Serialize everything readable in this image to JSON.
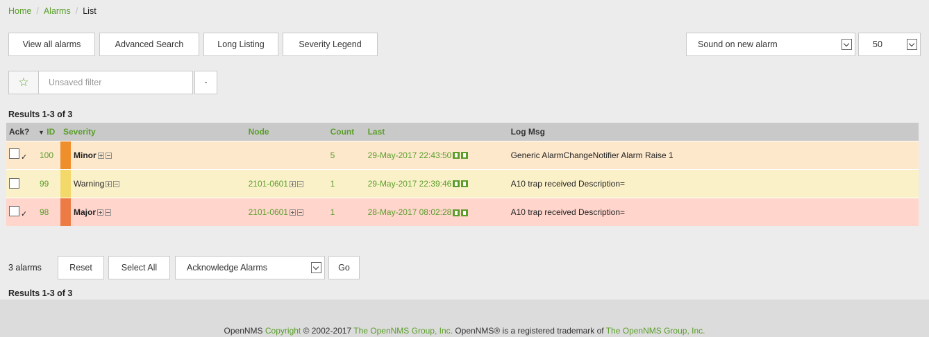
{
  "breadcrumb": {
    "home": "Home",
    "alarms": "Alarms",
    "current": "List",
    "separator": "/"
  },
  "toolbar": {
    "view_all": "View all alarms",
    "advanced_search": "Advanced Search",
    "long_listing": "Long Listing",
    "severity_legend": "Severity Legend",
    "sound_select": "Sound on new alarm",
    "page_size": "50"
  },
  "filter": {
    "placeholder": "Unsaved filter",
    "star_icon": "☆",
    "dropdown_glyph": "-"
  },
  "results_top": "Results 1-3 of 3",
  "results_bottom": "Results 1-3 of 3",
  "table": {
    "headers": {
      "ack": "Ack?",
      "sort_arrow": "▼",
      "id": "ID",
      "severity": "Severity",
      "node": "Node",
      "count": "Count",
      "last": "Last",
      "logmsg": "Log Msg"
    },
    "rows": [
      {
        "id": "100",
        "severity": "Minor",
        "node": "",
        "count": "5",
        "last": "29-May-2017 22:43:50",
        "logmsg": "Generic AlarmChangeNotifier Alarm Raise 1",
        "ack_mark": "✓",
        "color": "#fde8cc"
      },
      {
        "id": "99",
        "severity": "Warning",
        "node": "2101-0601",
        "count": "1",
        "last": "29-May-2017 22:39:46",
        "logmsg": "A10 trap received Description=",
        "ack_mark": "",
        "color": "#fbf1c9"
      },
      {
        "id": "98",
        "severity": "Major",
        "node": "2101-0601",
        "count": "1",
        "last": "28-May-2017 08:02:28",
        "logmsg": "A10 trap received Description=",
        "ack_mark": "✓",
        "color": "#ffd5cc"
      }
    ]
  },
  "bottom_bar": {
    "count_label": "3 alarms",
    "reset": "Reset",
    "select_all": "Select All",
    "action_select": "Acknowledge Alarms",
    "go": "Go"
  },
  "footer": {
    "prefix": "OpenNMS ",
    "copyright_link": "Copyright",
    "years": " © 2002-2017 ",
    "group_link_1": "The OpenNMS Group, Inc.",
    "middle": " OpenNMS® is a registered trademark of ",
    "group_link_2": "The OpenNMS Group, Inc."
  },
  "colors": {
    "accent": "#5a9e2a",
    "minor": "#ef8f2b",
    "warning": "#f3d86a",
    "major": "#ed7b45"
  }
}
